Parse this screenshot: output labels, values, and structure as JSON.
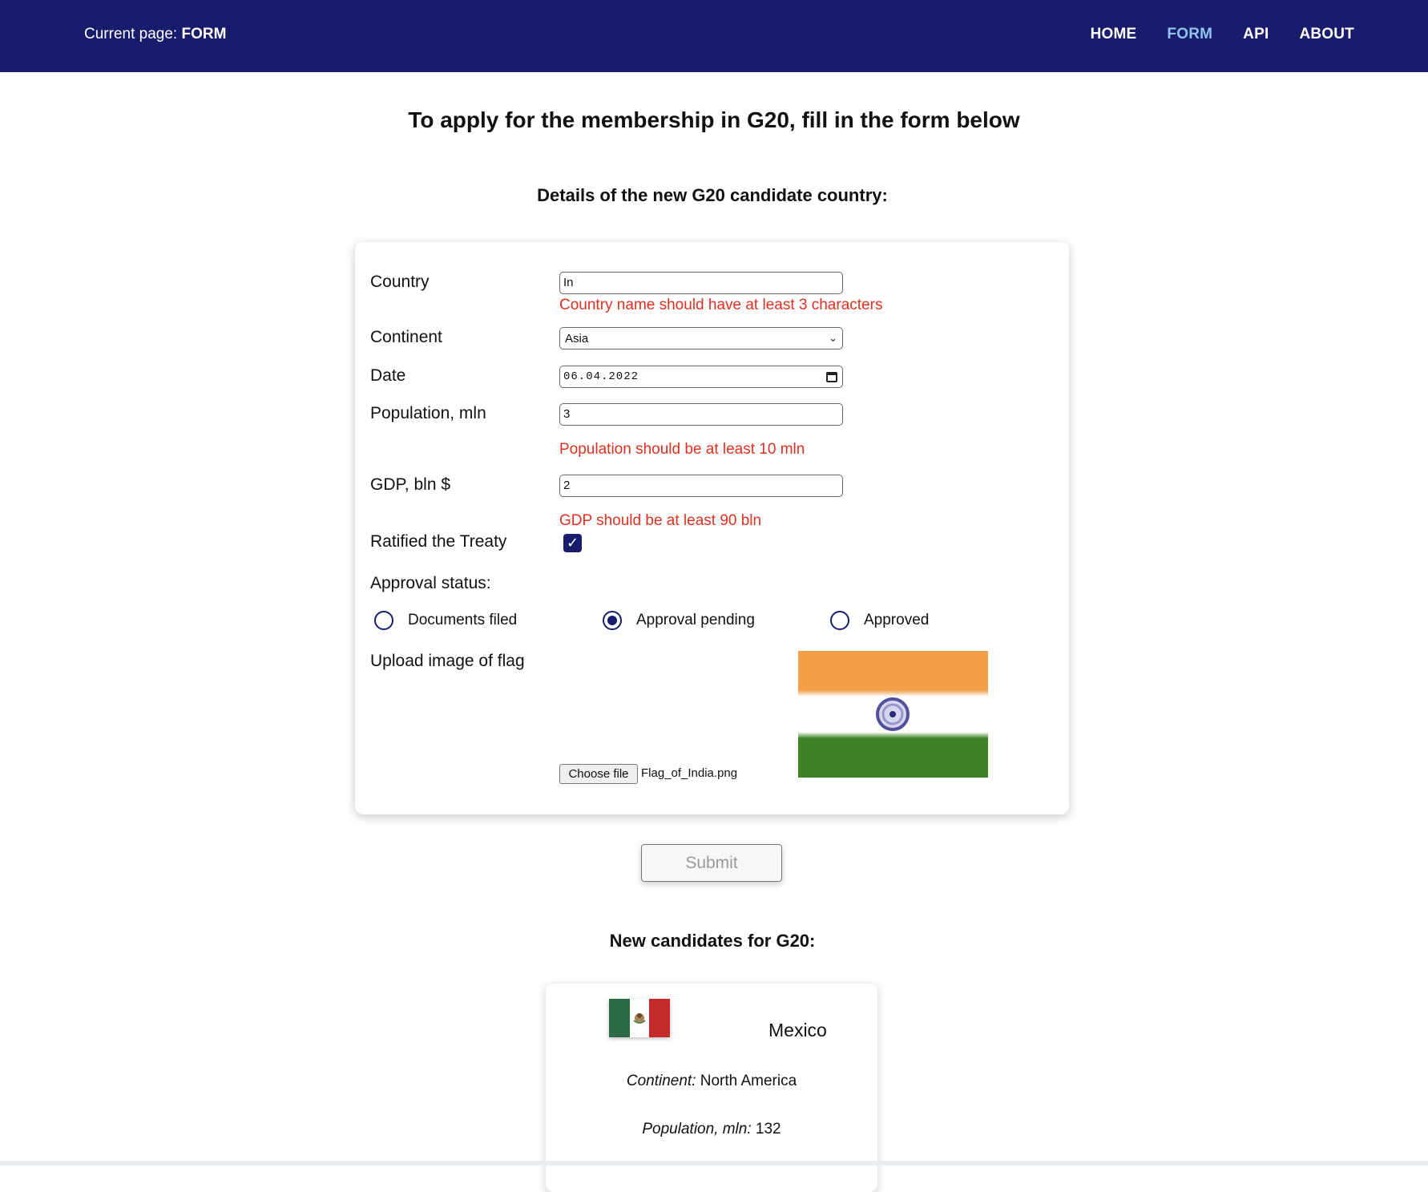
{
  "header": {
    "current_page_prefix": "Current page: ",
    "current_page": "FORM",
    "nav": [
      "HOME",
      "FORM",
      "API",
      "ABOUT"
    ],
    "active_nav": "FORM"
  },
  "main": {
    "title": "To apply for the membership in G20, fill in the form below",
    "form_heading": "Details of the new G20 candidate country:"
  },
  "form": {
    "country_label": "Country",
    "country_value": "In",
    "country_error": "Country name should have at least 3 characters",
    "continent_label": "Continent",
    "continent_value": "Asia",
    "date_label": "Date",
    "date_value": "06.04.2022",
    "population_label": "Population, mln",
    "population_value": "3",
    "population_error": "Population should be at least 10 mln",
    "gdp_label": "GDP, bln $",
    "gdp_value": "2",
    "gdp_error": "GDP should be at least 90 bln",
    "treaty_label": "Ratified the Treaty",
    "treaty_checked": true,
    "approval_label": "Approval status:",
    "approval_options": [
      "Documents filed",
      "Approval pending",
      "Approved"
    ],
    "approval_selected": "Approval pending",
    "upload_label": "Upload image of flag",
    "choose_file_label": "Choose file",
    "file_name": "Flag_of_India.png",
    "submit_label": "Submit"
  },
  "candidates": {
    "heading": "New candidates for G20:",
    "items": [
      {
        "name": "Mexico",
        "continent_label": "Continent:",
        "continent": "North America",
        "population_label": "Population, mln:",
        "population": "132"
      }
    ]
  },
  "colors": {
    "header_bg": "#181c6c",
    "active_nav": "#8fc4ef",
    "error": "#e03020",
    "accent": "#181c6c"
  }
}
